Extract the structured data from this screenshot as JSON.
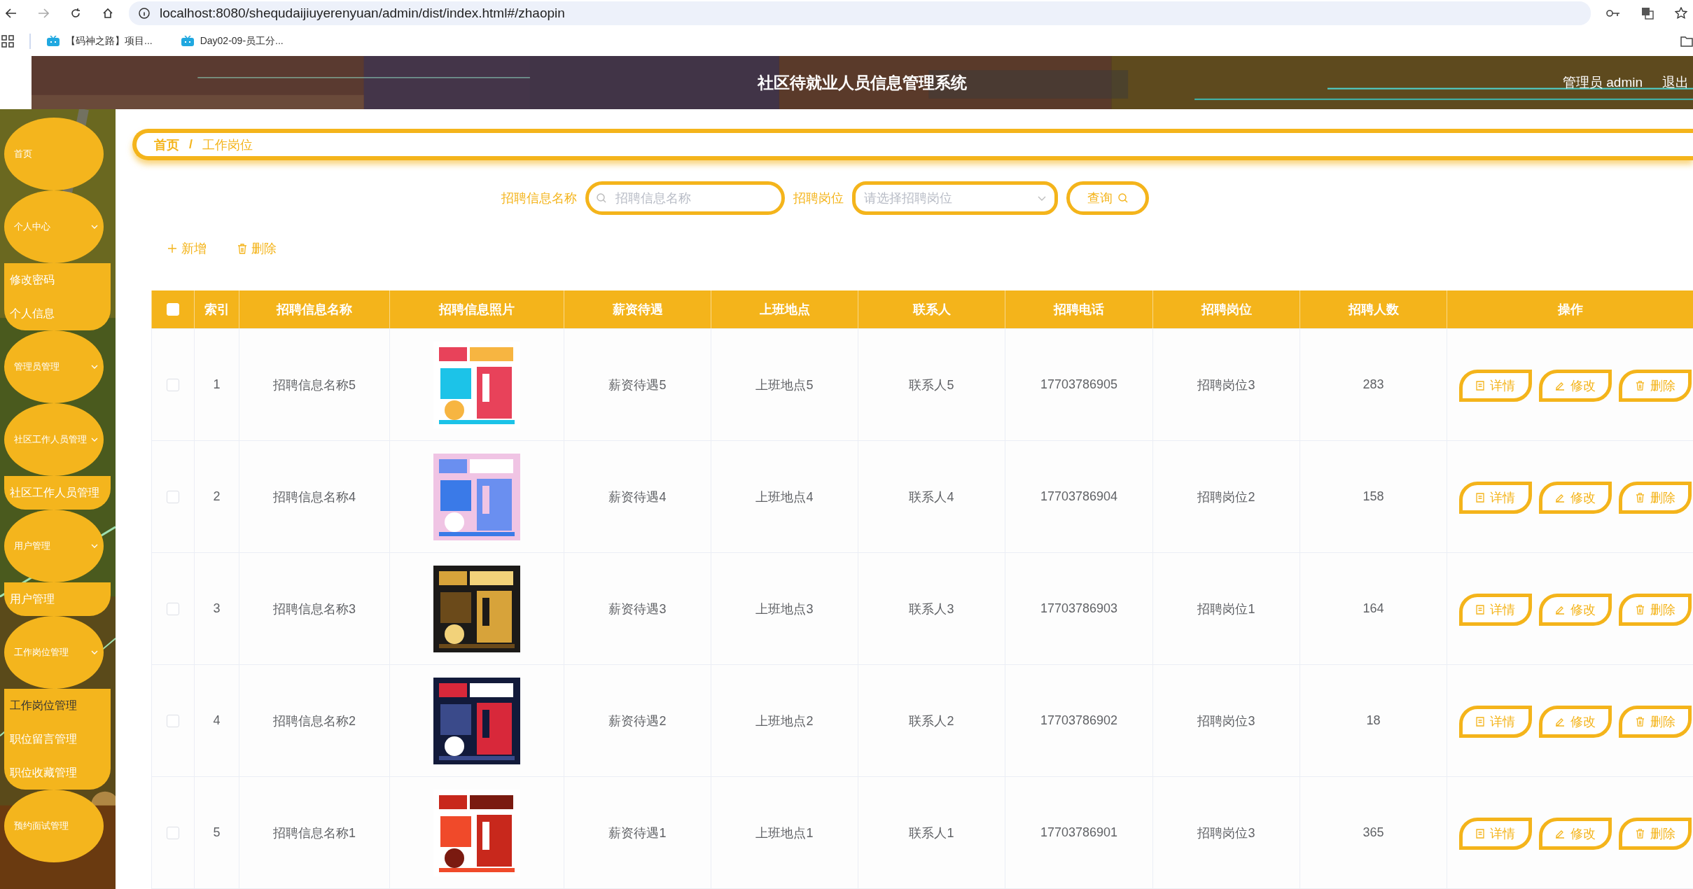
{
  "browser": {
    "url": "localhost:8080/shequdaijiuyerenyuan/admin/dist/index.html#/zhaopin",
    "bookmarks": [
      "【码神之路】项目...",
      "Day02-09-员工分..."
    ]
  },
  "header": {
    "title": "社区待就业人员信息管理系统",
    "user": "管理员 admin",
    "logout": "退出"
  },
  "sidebar": {
    "items": [
      {
        "kind": "link",
        "label": "首页"
      },
      {
        "kind": "submenu",
        "label": "个人中心",
        "expanded": true,
        "children": [
          {
            "label": "修改密码",
            "selected": false
          },
          {
            "label": "个人信息",
            "selected": false
          }
        ]
      },
      {
        "kind": "submenu",
        "label": "管理员管理",
        "expanded": false
      },
      {
        "kind": "submenu",
        "label": "社区工作人员管理",
        "expanded": true,
        "children": [
          {
            "label": "社区工作人员管理",
            "selected": false
          }
        ]
      },
      {
        "kind": "submenu",
        "label": "用户管理",
        "expanded": true,
        "children": [
          {
            "label": "用户管理",
            "selected": false
          }
        ]
      },
      {
        "kind": "submenu",
        "label": "工作岗位管理",
        "expanded": true,
        "children": [
          {
            "label": "工作岗位管理",
            "selected": true
          },
          {
            "label": "职位留言管理",
            "selected": false
          },
          {
            "label": "职位收藏管理",
            "selected": false
          }
        ]
      },
      {
        "kind": "link",
        "label": "预约面试管理"
      }
    ]
  },
  "breadcrumb": {
    "items": [
      "首页",
      "工作岗位"
    ],
    "separator": "/"
  },
  "search": {
    "name_label": "招聘信息名称",
    "name_placeholder": "招聘信息名称",
    "position_label": "招聘岗位",
    "position_placeholder": "请选择招聘岗位",
    "button": "查询"
  },
  "actions": [
    {
      "kind": "add",
      "label": "新增"
    },
    {
      "kind": "delete",
      "label": "删除"
    }
  ],
  "table": {
    "select_all_checked": false,
    "columns": [
      "索引",
      "招聘信息名称",
      "招聘信息照片",
      "薪资待遇",
      "上班地点",
      "联系人",
      "招聘电话",
      "招聘岗位",
      "招聘人数",
      "操作"
    ],
    "rows": [
      {
        "checked": false,
        "index": "1",
        "name": "招聘信息名称5",
        "salary": "薪资待遇5",
        "location": "上班地点5",
        "contact": "联系人5",
        "phone": "17703786905",
        "position": "招聘岗位3",
        "count": "283",
        "actions": [
          {
            "kind": "detail",
            "label": "详情"
          },
          {
            "kind": "edit",
            "label": "修改"
          },
          {
            "kind": "delete",
            "label": "删除"
          }
        ]
      },
      {
        "checked": false,
        "index": "2",
        "name": "招聘信息名称4",
        "salary": "薪资待遇4",
        "location": "上班地点4",
        "contact": "联系人4",
        "phone": "17703786904",
        "position": "招聘岗位2",
        "count": "158",
        "actions": [
          {
            "kind": "detail",
            "label": "详情"
          },
          {
            "kind": "edit",
            "label": "修改"
          },
          {
            "kind": "delete",
            "label": "删除"
          }
        ]
      },
      {
        "checked": false,
        "index": "3",
        "name": "招聘信息名称3",
        "salary": "薪资待遇3",
        "location": "上班地点3",
        "contact": "联系人3",
        "phone": "17703786903",
        "position": "招聘岗位1",
        "count": "164",
        "actions": [
          {
            "kind": "detail",
            "label": "详情"
          },
          {
            "kind": "edit",
            "label": "修改"
          },
          {
            "kind": "delete",
            "label": "删除"
          }
        ]
      },
      {
        "checked": false,
        "index": "4",
        "name": "招聘信息名称2",
        "salary": "薪资待遇2",
        "location": "上班地点2",
        "contact": "联系人2",
        "phone": "17703786902",
        "position": "招聘岗位3",
        "count": "18",
        "actions": [
          {
            "kind": "detail",
            "label": "详情"
          },
          {
            "kind": "edit",
            "label": "修改"
          },
          {
            "kind": "delete",
            "label": "删除"
          }
        ]
      },
      {
        "checked": false,
        "index": "5",
        "name": "招聘信息名称1",
        "salary": "薪资待遇1",
        "location": "上班地点1",
        "contact": "联系人1",
        "phone": "17703786901",
        "position": "招聘岗位3",
        "count": "365",
        "actions": [
          {
            "kind": "detail",
            "label": "详情"
          },
          {
            "kind": "edit",
            "label": "修改"
          },
          {
            "kind": "delete",
            "label": "删除"
          }
        ]
      }
    ]
  }
}
